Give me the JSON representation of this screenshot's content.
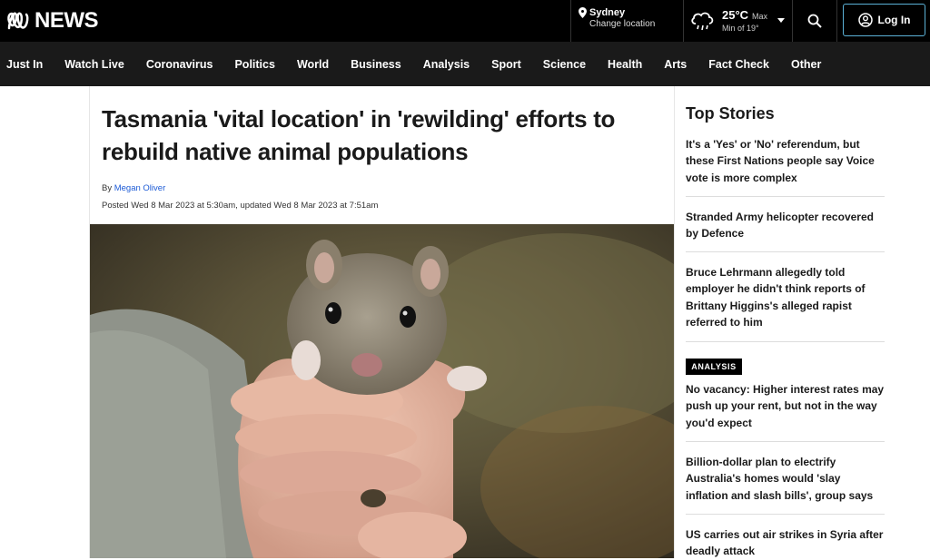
{
  "header": {
    "logo_text": "NEWS",
    "location": {
      "city": "Sydney",
      "change_label": "Change location"
    },
    "weather": {
      "temp": "25°C",
      "max_label": "Max",
      "min_label": "Min of 19°"
    },
    "login_label": "Log In",
    "icons": {
      "logo": "abc-logo-icon",
      "pin": "location-pin-icon",
      "weather": "cloud-rain-icon",
      "search": "search-icon",
      "user": "user-icon"
    }
  },
  "nav": {
    "items": [
      "Just In",
      "Watch Live",
      "Coronavirus",
      "Politics",
      "World",
      "Business",
      "Analysis",
      "Sport",
      "Science",
      "Health",
      "Arts",
      "Fact Check",
      "Other"
    ]
  },
  "article": {
    "headline": "Tasmania 'vital location' in 'rewilding' efforts to rebuild native animal populations",
    "by_label": "By",
    "author": "Megan Oliver",
    "dates": "Posted Wed 8 Mar 2023 at 5:30am, updated Wed 8 Mar 2023 at 7:51am"
  },
  "sidebar": {
    "title": "Top Stories",
    "stories": [
      "It's a 'Yes' or 'No' referendum, but these First Nations people say Voice vote is more complex",
      "Stranded Army helicopter recovered by Defence",
      "Bruce Lehrmann allegedly told employer he didn't think reports of Brittany Higgins's alleged rapist referred to him",
      "No vacancy: Higher interest rates may push up your rent, but not in the way you'd expect",
      "Billion-dollar plan to electrify Australia's homes would 'slay inflation and slash bills', group says",
      "US carries out air strikes in Syria after deadly attack"
    ],
    "analysis_badge": "ANALYSIS"
  },
  "colors": {
    "topbar": "#000000",
    "nav": "#1a1a1a",
    "link": "#1d5bd6",
    "login_border": "#5bb1d6"
  }
}
